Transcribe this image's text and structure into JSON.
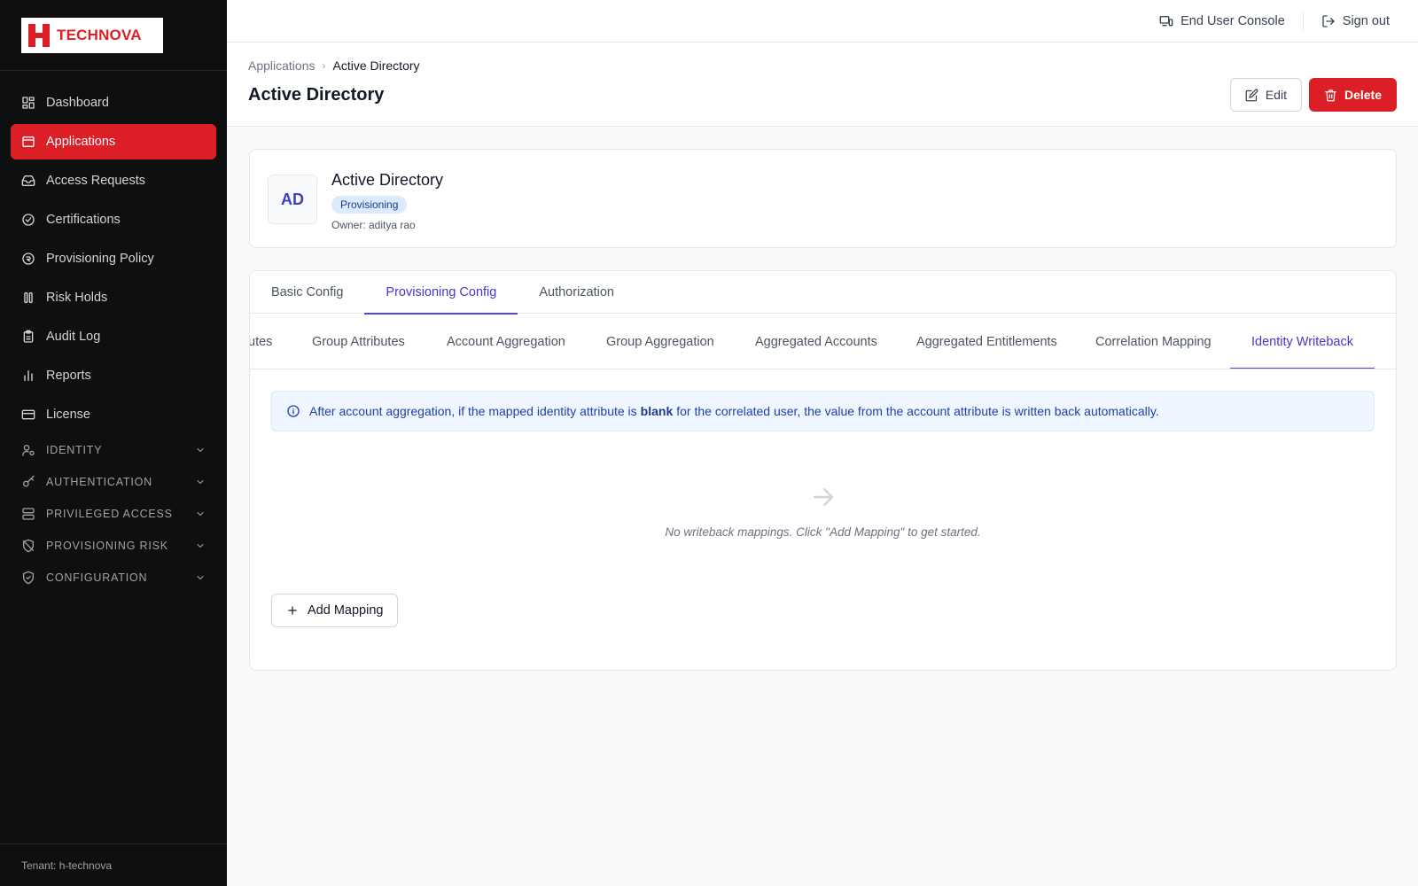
{
  "brand": {
    "name": "TECHNOVA",
    "color": "#dc1f26"
  },
  "topbar": {
    "console_label": "End User Console",
    "signout_label": "Sign out"
  },
  "sidebar": {
    "items": [
      {
        "label": "Dashboard",
        "icon": "dashboard-icon"
      },
      {
        "label": "Applications",
        "icon": "applications-icon",
        "active": true
      },
      {
        "label": "Access Requests",
        "icon": "inbox-icon"
      },
      {
        "label": "Certifications",
        "icon": "check-circle-icon"
      },
      {
        "label": "Provisioning Policy",
        "icon": "policy-icon"
      },
      {
        "label": "Risk Holds",
        "icon": "pause-icon"
      },
      {
        "label": "Audit Log",
        "icon": "clipboard-icon"
      },
      {
        "label": "Reports",
        "icon": "bar-chart-icon"
      },
      {
        "label": "License",
        "icon": "card-icon"
      }
    ],
    "sections": [
      {
        "label": "IDENTITY",
        "icon": "user-cog-icon"
      },
      {
        "label": "AUTHENTICATION",
        "icon": "key-icon"
      },
      {
        "label": "PRIVILEGED ACCESS",
        "icon": "server-icon"
      },
      {
        "label": "PROVISIONING RISK",
        "icon": "shield-off-icon"
      },
      {
        "label": "CONFIGURATION",
        "icon": "shield-check-icon"
      }
    ],
    "tenant": "Tenant: h-technova"
  },
  "breadcrumb": {
    "parent": "Applications",
    "current": "Active Directory"
  },
  "header": {
    "title": "Active Directory",
    "edit_label": "Edit",
    "delete_label": "Delete"
  },
  "app": {
    "initials": "AD",
    "name": "Active Directory",
    "badge": "Provisioning",
    "owner": "Owner: aditya rao"
  },
  "tabs": [
    {
      "label": "Basic Config"
    },
    {
      "label": "Provisioning Config",
      "active": true
    },
    {
      "label": "Authorization"
    }
  ],
  "subtabs": [
    {
      "label": "utes"
    },
    {
      "label": "Group Attributes"
    },
    {
      "label": "Account Aggregation"
    },
    {
      "label": "Group Aggregation"
    },
    {
      "label": "Aggregated Accounts"
    },
    {
      "label": "Aggregated Entitlements"
    },
    {
      "label": "Correlation Mapping"
    },
    {
      "label": "Identity Writeback",
      "active": true
    }
  ],
  "info": {
    "before": "After account aggregation, if the mapped identity attribute is",
    "bold": "blank",
    "after": "for the correlated user, the value from the account attribute is written back automatically."
  },
  "empty": {
    "text": "No writeback mappings. Click \"Add Mapping\" to get started."
  },
  "add_mapping_label": "Add Mapping"
}
